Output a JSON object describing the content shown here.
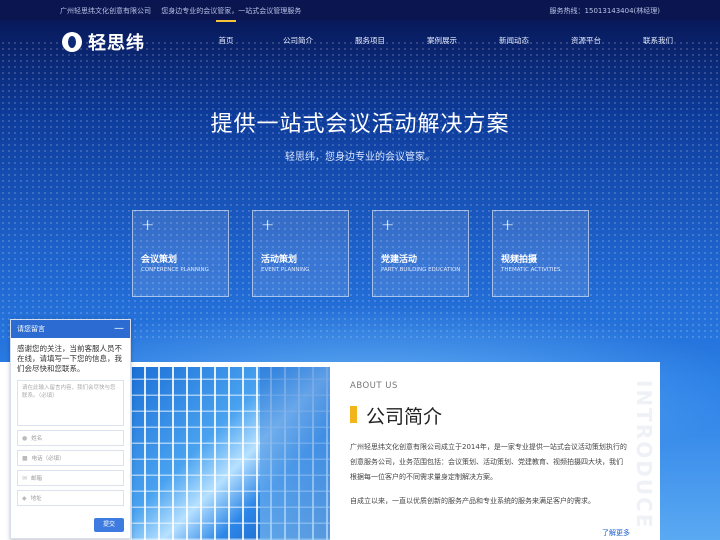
{
  "topbar": {
    "company": "广州轻思纬文化创意有限公司",
    "slogan": "您身边专业的会议管家，一站式会议管理服务",
    "hotline": "服务热线：15013143404(林经理)"
  },
  "brand": {
    "name": "轻思纬",
    "logo_icon": "logo-mark-icon"
  },
  "nav": [
    "首页",
    "公司简介",
    "服务项目",
    "案例展示",
    "新闻动态",
    "资源平台",
    "联系我们"
  ],
  "hero": {
    "title": "提供一站式会议活动解决方案",
    "subtitle": "轻思纬，您身边专业的会议管家。"
  },
  "services": [
    {
      "title": "会议策划",
      "en": "CONFERENCE PLANNING",
      "icon": "plus-icon"
    },
    {
      "title": "活动策划",
      "en": "EVENT PLANNING",
      "icon": "plus-icon"
    },
    {
      "title": "党建活动",
      "en": "PARTY BUILDING EDUCATION",
      "icon": "plus-icon"
    },
    {
      "title": "视频拍摄",
      "en": "THEMATIC ACTIVITIES",
      "icon": "plus-icon"
    }
  ],
  "about": {
    "en": "ABOUT US",
    "title": "公司简介",
    "p1": "广州轻思纬文化创意有限公司成立于2014年，是一家专业提供一站式会议活动策划执行的创意服务公司，业务范围包括：会议策划、活动策划、党建教育、视频拍摄四大块，我们根据每一位客户的不同需求量身定制解决方案。",
    "p2": "自成立以来，一直以优质创新的服务产品和专业系统的服务来满足客户的需求。",
    "more": "了解更多",
    "vertical": "INTRODUCE"
  },
  "chat": {
    "header": "请您留言",
    "minimize": "—",
    "message": "感谢您的关注，当前客服人员不在线，请填写一下您的信息，我们会尽快和您联系。",
    "textarea_placeholder": "请在此输入留言内容，我们会尽快与您联系。（必填）",
    "fields": [
      {
        "icon": "user-icon",
        "placeholder": "姓名"
      },
      {
        "icon": "phone-icon",
        "placeholder": "电话（必填）"
      },
      {
        "icon": "mail-icon",
        "placeholder": "邮箱"
      },
      {
        "icon": "location-icon",
        "placeholder": "地址"
      }
    ],
    "send": "提交"
  }
}
